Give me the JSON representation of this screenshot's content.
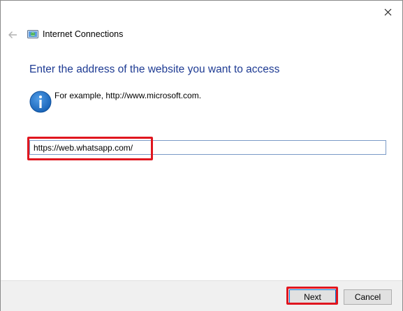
{
  "window": {
    "title": "Internet Connections"
  },
  "page": {
    "heading": "Enter the address of the website you want to access",
    "example": "For example, http://www.microsoft.com."
  },
  "address": {
    "value": "https://web.whatsapp.com/"
  },
  "buttons": {
    "next": "Next",
    "cancel": "Cancel"
  },
  "icons": {
    "close": "close-icon",
    "back": "back-arrow-icon",
    "app": "internet-connections-icon",
    "info": "info-icon"
  },
  "colors": {
    "heading": "#1e3b93",
    "highlight": "#e0161f",
    "info_icon": "#1a6fc7",
    "input_border": "#7a9ac7",
    "default_button_border": "#0078d7"
  }
}
